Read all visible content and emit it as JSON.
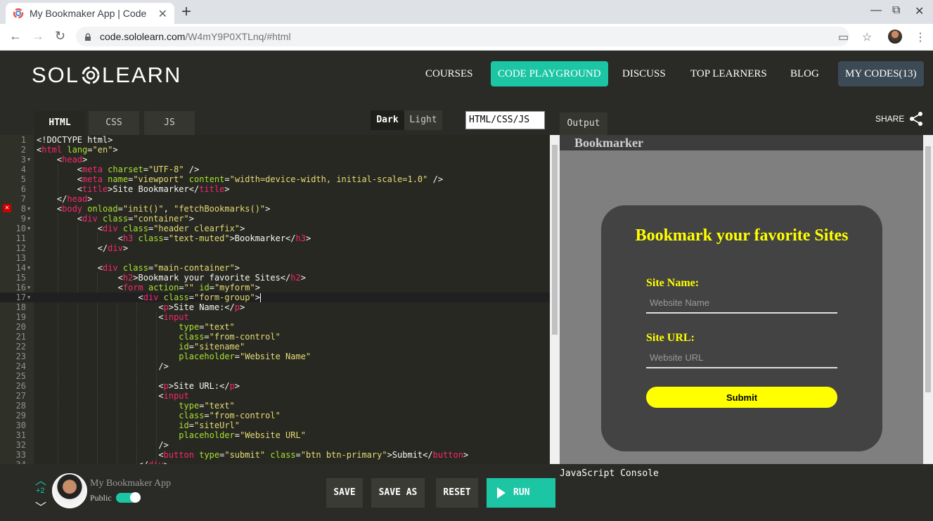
{
  "browser": {
    "tab_title": "My Bookmaker App | Code",
    "url_host": "code.sololearn.com",
    "url_path": "/W4mY9P0XTLnq/#html",
    "new_tab": "+",
    "close": "✕"
  },
  "site": {
    "logo_left": "SOL",
    "logo_right": "LEARN",
    "nav": [
      {
        "label": "COURSES"
      },
      {
        "label": "CODE PLAYGROUND"
      },
      {
        "label": "DISCUSS"
      },
      {
        "label": "TOP LEARNERS"
      },
      {
        "label": "BLOG"
      },
      {
        "label": "MY CODES(13)"
      }
    ],
    "accent_color": "#1cc5a3"
  },
  "editor": {
    "tabs": [
      "HTML",
      "CSS",
      "JS"
    ],
    "active_tab": "HTML",
    "theme_dark": "Dark",
    "theme_light": "Light",
    "language": "HTML/CSS/JS",
    "lines": [
      {
        "n": "1",
        "html": "&lt;!DOCTYPE html&gt;"
      },
      {
        "n": "2",
        "html": "&lt;<span class='t'>html</span> <span class='a'>lang</span>=<span class='s'>\"en\"</span>&gt;"
      },
      {
        "n": "3",
        "html": "    &lt;<span class='t'>head</span>&gt;",
        "fold": true
      },
      {
        "n": "4",
        "html": "        &lt;<span class='t'>meta</span> <span class='a'>charset</span>=<span class='s'>\"UTF-8\"</span> /&gt;"
      },
      {
        "n": "5",
        "html": "        &lt;<span class='t'>meta</span> <span class='a'>name</span>=<span class='s'>\"viewport\"</span> <span class='a'>content</span>=<span class='s'>\"width=device-width, initial-scale=1.0\"</span> /&gt;"
      },
      {
        "n": "6",
        "html": "        &lt;<span class='t'>title</span>&gt;Site Bookmarker&lt;/<span class='t'>title</span>&gt;"
      },
      {
        "n": "7",
        "html": "    &lt;/<span class='t'>head</span>&gt;"
      },
      {
        "n": "8",
        "html": "    &lt;<span class='t'>body</span> <span class='a'>onload</span>=<span class='s'>\"init()\"</span>, <span class='s'>\"fetchBookmarks()\"</span>&gt;",
        "fold": true,
        "error": true
      },
      {
        "n": "9",
        "html": "        &lt;<span class='t'>div</span> <span class='a'>class</span>=<span class='s'>\"container\"</span>&gt;",
        "fold": true
      },
      {
        "n": "10",
        "html": "            &lt;<span class='t'>div</span> <span class='a'>class</span>=<span class='s'>\"header clearfix\"</span>&gt;",
        "fold": true
      },
      {
        "n": "11",
        "html": "                &lt;<span class='t'>h3</span> <span class='a'>class</span>=<span class='s'>\"text-muted\"</span>&gt;Bookmarker&lt;/<span class='t'>h3</span>&gt;"
      },
      {
        "n": "12",
        "html": "            &lt;/<span class='t'>div</span>&gt;"
      },
      {
        "n": "13",
        "html": ""
      },
      {
        "n": "14",
        "html": "            &lt;<span class='t'>div</span> <span class='a'>class</span>=<span class='s'>\"main-container\"</span>&gt;",
        "fold": true
      },
      {
        "n": "15",
        "html": "                &lt;<span class='t'>h2</span>&gt;Bookmark your favorite Sites&lt;/<span class='t'>h2</span>&gt;"
      },
      {
        "n": "16",
        "html": "                &lt;<span class='t'>form</span> <span class='a'>action</span>=<span class='s'>\"\"</span> <span class='a'>id</span>=<span class='s'>\"myform\"</span>&gt;",
        "fold": true
      },
      {
        "n": "17",
        "html": "                    &lt;<span class='t'>div</span> <span class='a'>class</span>=<span class='s'>\"form-group\"</span>&gt;<span class='cursor'></span>",
        "fold": true,
        "active": true
      },
      {
        "n": "18",
        "html": "                        &lt;<span class='t'>p</span>&gt;Site Name:&lt;/<span class='t'>p</span>&gt;"
      },
      {
        "n": "19",
        "html": "                        &lt;<span class='t'>input</span>"
      },
      {
        "n": "20",
        "html": "                            <span class='a'>type</span>=<span class='s'>\"text\"</span>"
      },
      {
        "n": "21",
        "html": "                            <span class='a'>class</span>=<span class='s'>\"from-control\"</span>"
      },
      {
        "n": "22",
        "html": "                            <span class='a'>id</span>=<span class='s'>\"sitename\"</span>"
      },
      {
        "n": "23",
        "html": "                            <span class='a'>placeholder</span>=<span class='s'>\"Website Name\"</span>"
      },
      {
        "n": "24",
        "html": "                        /&gt;"
      },
      {
        "n": "25",
        "html": ""
      },
      {
        "n": "26",
        "html": "                        &lt;<span class='t'>p</span>&gt;Site URL:&lt;/<span class='t'>p</span>&gt;"
      },
      {
        "n": "27",
        "html": "                        &lt;<span class='t'>input</span>"
      },
      {
        "n": "28",
        "html": "                            <span class='a'>type</span>=<span class='s'>\"text\"</span>"
      },
      {
        "n": "29",
        "html": "                            <span class='a'>class</span>=<span class='s'>\"from-control\"</span>"
      },
      {
        "n": "30",
        "html": "                            <span class='a'>id</span>=<span class='s'>\"siteUrl\"</span>"
      },
      {
        "n": "31",
        "html": "                            <span class='a'>placeholder</span>=<span class='s'>\"Website URL\"</span>"
      },
      {
        "n": "32",
        "html": "                        /&gt;"
      },
      {
        "n": "33",
        "html": "                        &lt;<span class='t'>button</span> <span class='a'>type</span>=<span class='s'>\"submit\"</span> <span class='a'>class</span>=<span class='s'>\"btn btn-primary\"</span>&gt;Submit&lt;/<span class='t'>button</span>&gt;"
      },
      {
        "n": "34",
        "html": "                    &lt;/<span class='t'>div</span>&gt;"
      }
    ]
  },
  "output": {
    "tab_label": "Output",
    "share_label": "SHARE",
    "header_title": "Bookmarker",
    "card_title": "Bookmark your favorite Sites",
    "site_name_label": "Site Name:",
    "site_name_placeholder": "Website Name",
    "site_url_label": "Site URL:",
    "site_url_placeholder": "Website URL",
    "submit_label": "Submit"
  },
  "bottom": {
    "vote_count": "+2",
    "code_name": "My Bookmaker App",
    "public_label": "Public",
    "public_on": true,
    "save_label": "SAVE",
    "save_as_label": "SAVE AS",
    "reset_label": "RESET",
    "run_label": "RUN"
  },
  "console": {
    "title": "JavaScript Console"
  }
}
